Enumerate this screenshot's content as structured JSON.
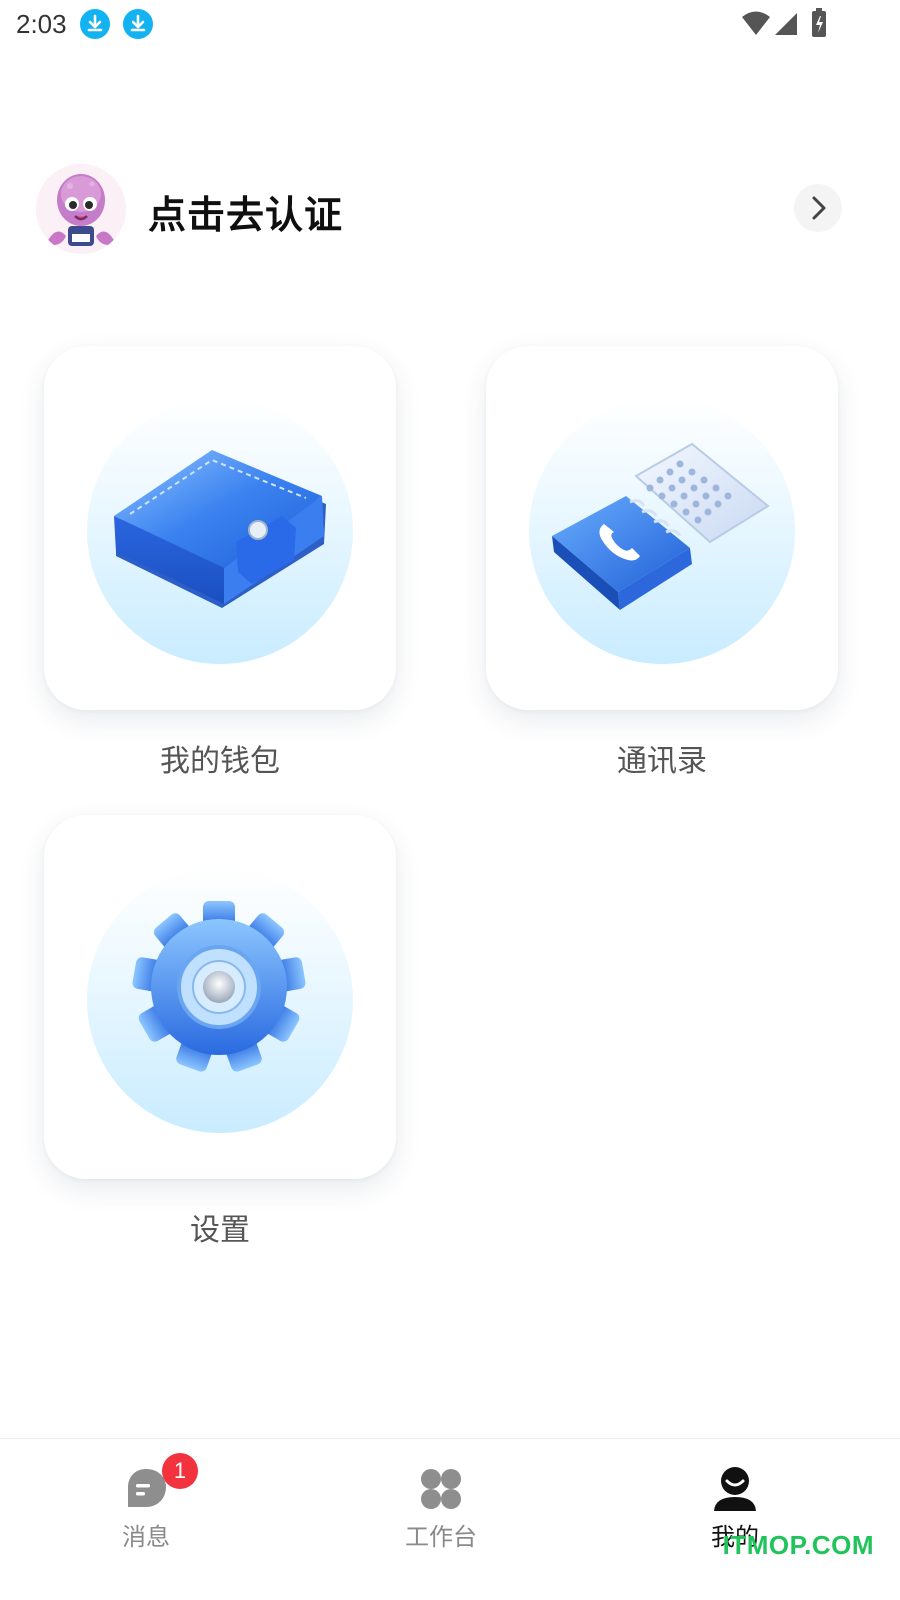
{
  "status_bar": {
    "time": "2:03",
    "icons": [
      "download-icon",
      "download-icon",
      "wifi-icon",
      "signal-icon",
      "battery-charging-icon"
    ]
  },
  "profile": {
    "name": "点击去认证",
    "avatar_icon": "octopus-avatar",
    "arrow_icon": "chevron-right-icon"
  },
  "grid": [
    {
      "label": "我的钱包",
      "icon": "wallet-icon"
    },
    {
      "label": "通讯录",
      "icon": "contacts-book-icon"
    },
    {
      "label": "设置",
      "icon": "gear-icon"
    }
  ],
  "bottom_nav": {
    "items": [
      {
        "label": "消息",
        "icon": "message-icon",
        "badge": "1",
        "active": false
      },
      {
        "label": "工作台",
        "icon": "workbench-icon",
        "active": false
      },
      {
        "label": "我的",
        "icon": "user-icon",
        "active": true
      }
    ]
  },
  "watermark": "ITMOP.COM",
  "colors": {
    "accent_blue": "#2f6fe8",
    "badge_red": "#f2323c",
    "download_cyan": "#12b3f0",
    "watermark_green": "#20c45a"
  }
}
